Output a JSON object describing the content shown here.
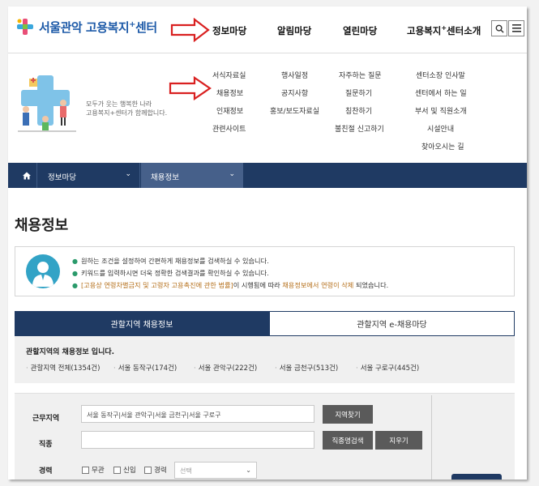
{
  "header": {
    "logo_main": "서울관악 고용복지",
    "logo_sup": "+",
    "logo_tail": "센터",
    "nav": [
      {
        "label": "정보마당",
        "sup": "",
        "tail": ""
      },
      {
        "label": "알림마당",
        "sup": "",
        "tail": ""
      },
      {
        "label": "열린마당",
        "sup": "",
        "tail": ""
      },
      {
        "label": "고용복지",
        "sup": "+",
        "tail": "센터소개"
      }
    ]
  },
  "mega": {
    "slogan_line1": "모두가 웃는 행복한 나라",
    "slogan_line2": "고용복지+센터가 함께합니다.",
    "col1": [
      "서식자료실",
      "채용정보",
      "인재정보",
      "관련사이트"
    ],
    "col2": [
      "행사일정",
      "공지사항",
      "홍보/보도자료실"
    ],
    "col3": [
      "자주하는 질문",
      "질문하기",
      "칭찬하기",
      "불친절 신고하기"
    ],
    "col4": [
      "센터소장 인사말",
      "센터에서 하는 일",
      "부서 및 직원소개",
      "시설안내",
      "찾아오시는 길"
    ]
  },
  "breadcrumb": {
    "level1": "정보마당",
    "level2": "채용정보"
  },
  "page": {
    "title": "채용정보"
  },
  "info": {
    "line1": "원하는 조건을 설정하여 간편하게 채용정보를 검색하실 수 있습니다.",
    "line2": "키워드를 입력하시면 더욱 정확한 검색결과를 확인하실 수 있습니다.",
    "line3_a": "[고용상 연령차별금지 및 고령자 고용촉진에 관한 법률]",
    "line3_b": "이 시행됨에 따라 ",
    "line3_c": "채용정보에서 연령이 삭제",
    "line3_d": " 되었습니다."
  },
  "tabs": {
    "active": "관할지역 채용정보",
    "inactive": "관할지역 e-채용마당"
  },
  "region": {
    "title": "관할지역의 채용정보 입니다.",
    "links": [
      "관할지역 전체(1354건)",
      "서울 동작구(174건)",
      "서울 관악구(222건)",
      "서울 금천구(513건)",
      "서울 구로구(445건)"
    ]
  },
  "form": {
    "label_location": "근무지역",
    "location_value": "서울 동작구|서울 관악구|서울 금천구|서울 구로구",
    "btn_region": "지역찾기",
    "label_job": "직종",
    "job_value": "",
    "btn_job": "직종명검색",
    "btn_clear": "지우기",
    "label_career": "경력",
    "checks": [
      "무관",
      "신입",
      "경력"
    ],
    "select_placeholder": "선택"
  },
  "colors": {
    "navy": "#1f3a63",
    "logo_blue": "#1d5aa8",
    "arrow_red": "#d92020"
  }
}
